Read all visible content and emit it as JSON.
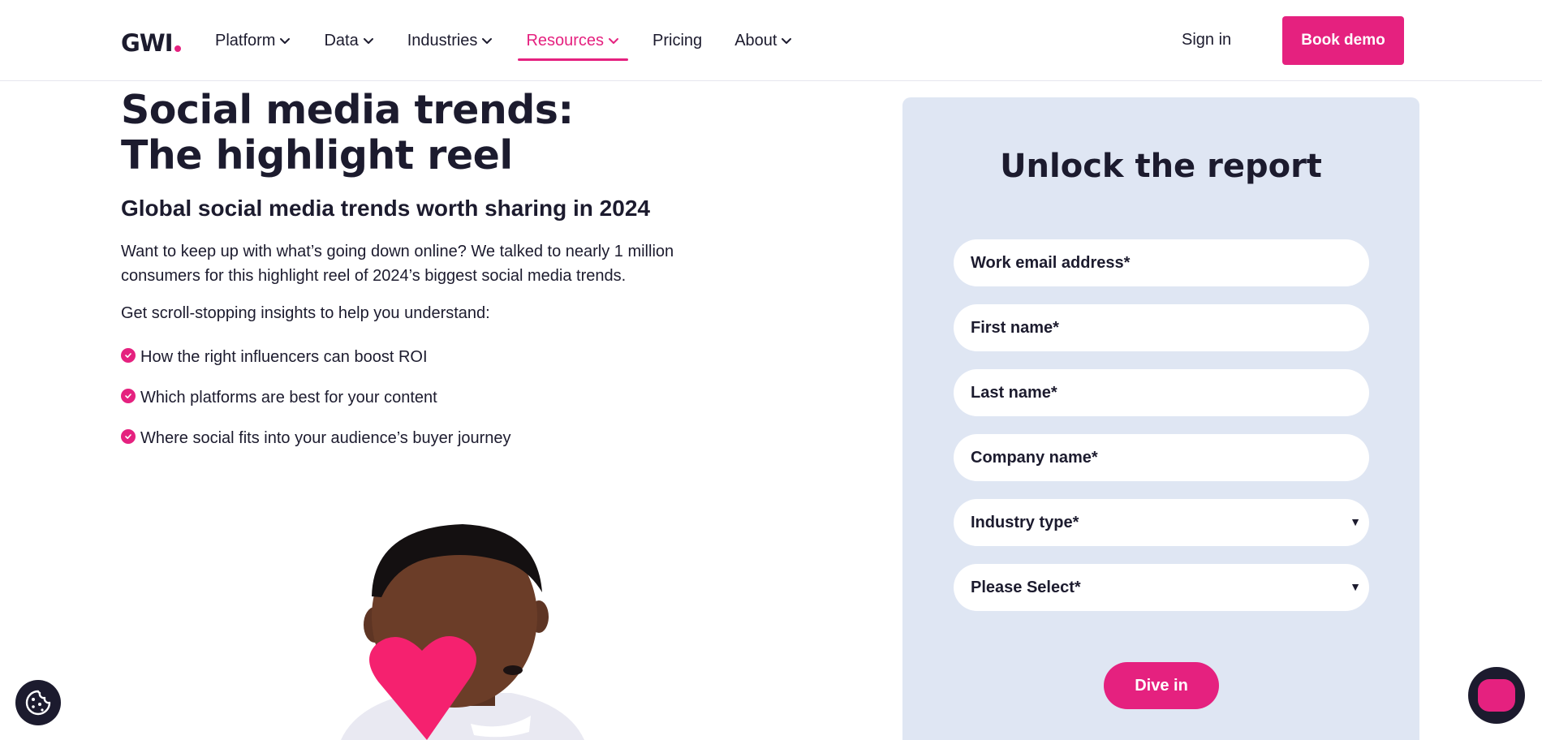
{
  "header": {
    "logo_text": "GWI",
    "nav": [
      {
        "label": "Platform",
        "dropdown": true
      },
      {
        "label": "Data",
        "dropdown": true
      },
      {
        "label": "Industries",
        "dropdown": true
      },
      {
        "label": "Resources",
        "dropdown": true,
        "active": true
      },
      {
        "label": "Pricing",
        "dropdown": false
      },
      {
        "label": "About",
        "dropdown": true
      }
    ],
    "sign_in": "Sign in",
    "book_demo": "Book demo"
  },
  "hero": {
    "title_line1": "Social media trends:",
    "title_line2": "The highlight reel",
    "subtitle": "Global social media trends worth sharing in 2024",
    "intro": "Want to keep up with what’s going down online? We talked to nearly 1 million consumers for this highlight reel of 2024’s biggest social media trends.",
    "lead": "Get scroll-stopping insights to help you understand:",
    "bullets": [
      "How the right influencers can boost ROI",
      "Which platforms are best for your content",
      "Where social fits into your audience’s buyer journey"
    ]
  },
  "form": {
    "title": "Unlock the report",
    "fields": {
      "email": "Work email address*",
      "first_name": "First name*",
      "last_name": "Last name*",
      "company": "Company name*",
      "industry": "Industry type*",
      "select": "Please Select*"
    },
    "submit": "Dive in"
  },
  "colors": {
    "brand_pink": "#e5217f",
    "navy": "#1c1b2e",
    "form_bg": "#dfe6f3"
  },
  "icons": {
    "chevron": "chevron-down-icon",
    "check": "check-circle-icon",
    "cookie": "cookie-icon",
    "chat": "chat-icon",
    "caret": "caret-down-icon"
  }
}
